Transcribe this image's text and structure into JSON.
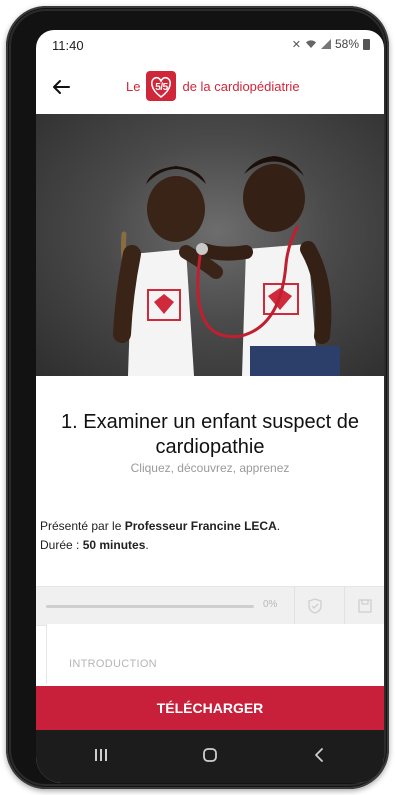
{
  "status_bar": {
    "time": "11:40",
    "battery": "58%",
    "icons": [
      "mute-icon",
      "wifi-icon",
      "signal-icon",
      "battery-icon"
    ]
  },
  "header": {
    "back_icon": "arrow-left-icon",
    "brand_prefix": "Le",
    "logo_text": "5/5",
    "brand_suffix": "de la cardiopédiatrie"
  },
  "course": {
    "title": "1. Examiner un enfant suspect de cardiopathie",
    "subtitle": "Cliquez, découvrez, apprenez",
    "presented_prefix": "Présenté par le ",
    "presenter": "Professeur Francine LECA",
    "presented_suffix": ".",
    "duration_prefix": "Durée : ",
    "duration": "50 minutes",
    "duration_suffix": "."
  },
  "progress": {
    "value": 0,
    "label": "0%",
    "icons": [
      "shield-check-icon",
      "save-icon"
    ]
  },
  "section": {
    "first": "INTRODUCTION"
  },
  "actions": {
    "download": "TÉLÉCHARGER"
  },
  "colors": {
    "accent": "#c8203a",
    "brand": "#d0263a",
    "navbar": "#1c1c1c"
  },
  "nav": {
    "recent": "recent-apps-icon",
    "home": "home-icon",
    "back": "back-icon"
  }
}
